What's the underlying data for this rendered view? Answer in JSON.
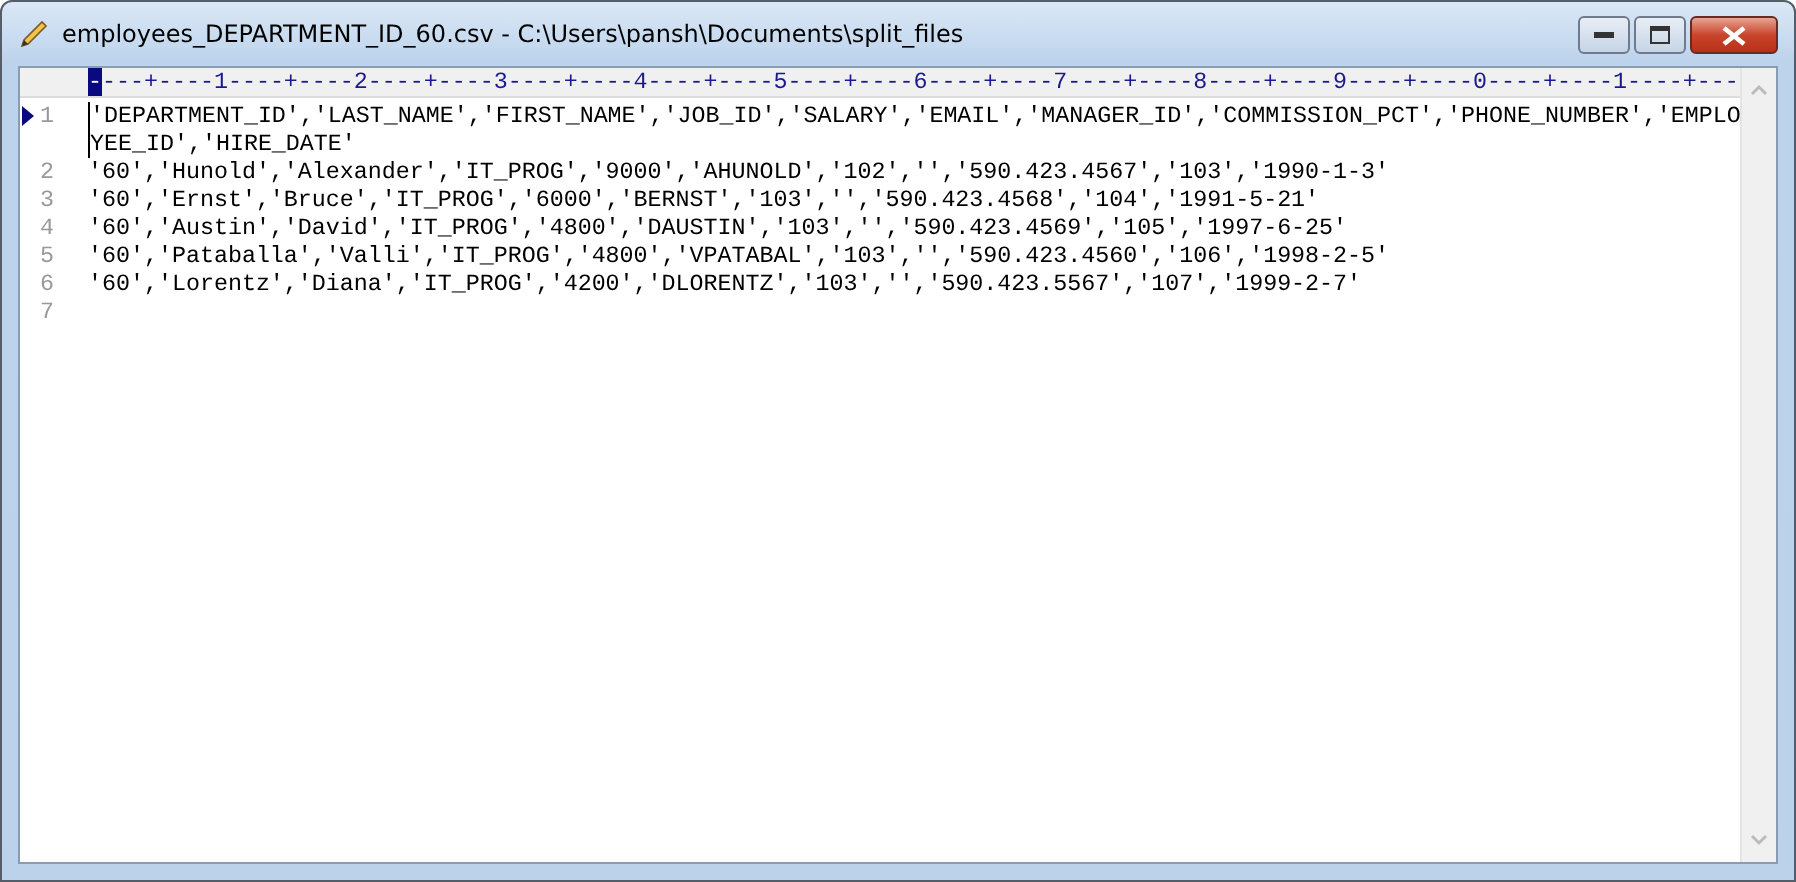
{
  "window": {
    "title": "employees_DEPARTMENT_ID_60.csv - C:\\Users\\pansh\\Documents\\split_files"
  },
  "ruler": {
    "marker": "-",
    "text": "---+----1----+----2----+----3----+----4----+----5----+----6----+----7----+----8----+----9----+----0----+----1----+---"
  },
  "lines": [
    {
      "number": "1",
      "current": true,
      "text": "'DEPARTMENT_ID','LAST_NAME','FIRST_NAME','JOB_ID','SALARY','EMAIL','MANAGER_ID','COMMISSION_PCT','PHONE_NUMBER','EMPLOYEE_ID','HIRE_DATE'"
    },
    {
      "number": "2",
      "current": false,
      "text": "'60','Hunold','Alexander','IT_PROG','9000','AHUNOLD','102','','590.423.4567','103','1990-1-3'"
    },
    {
      "number": "3",
      "current": false,
      "text": "'60','Ernst','Bruce','IT_PROG','6000','BERNST','103','','590.423.4568','104','1991-5-21'"
    },
    {
      "number": "4",
      "current": false,
      "text": "'60','Austin','David','IT_PROG','4800','DAUSTIN','103','','590.423.4569','105','1997-6-25'"
    },
    {
      "number": "5",
      "current": false,
      "text": "'60','Pataballa','Valli','IT_PROG','4800','VPATABAL','103','','590.423.4560','106','1998-2-5'"
    },
    {
      "number": "6",
      "current": false,
      "text": "'60','Lorentz','Diana','IT_PROG','4200','DLORENTZ','103','','590.423.5567','107','1999-2-7'"
    },
    {
      "number": "7",
      "current": false
    }
  ]
}
